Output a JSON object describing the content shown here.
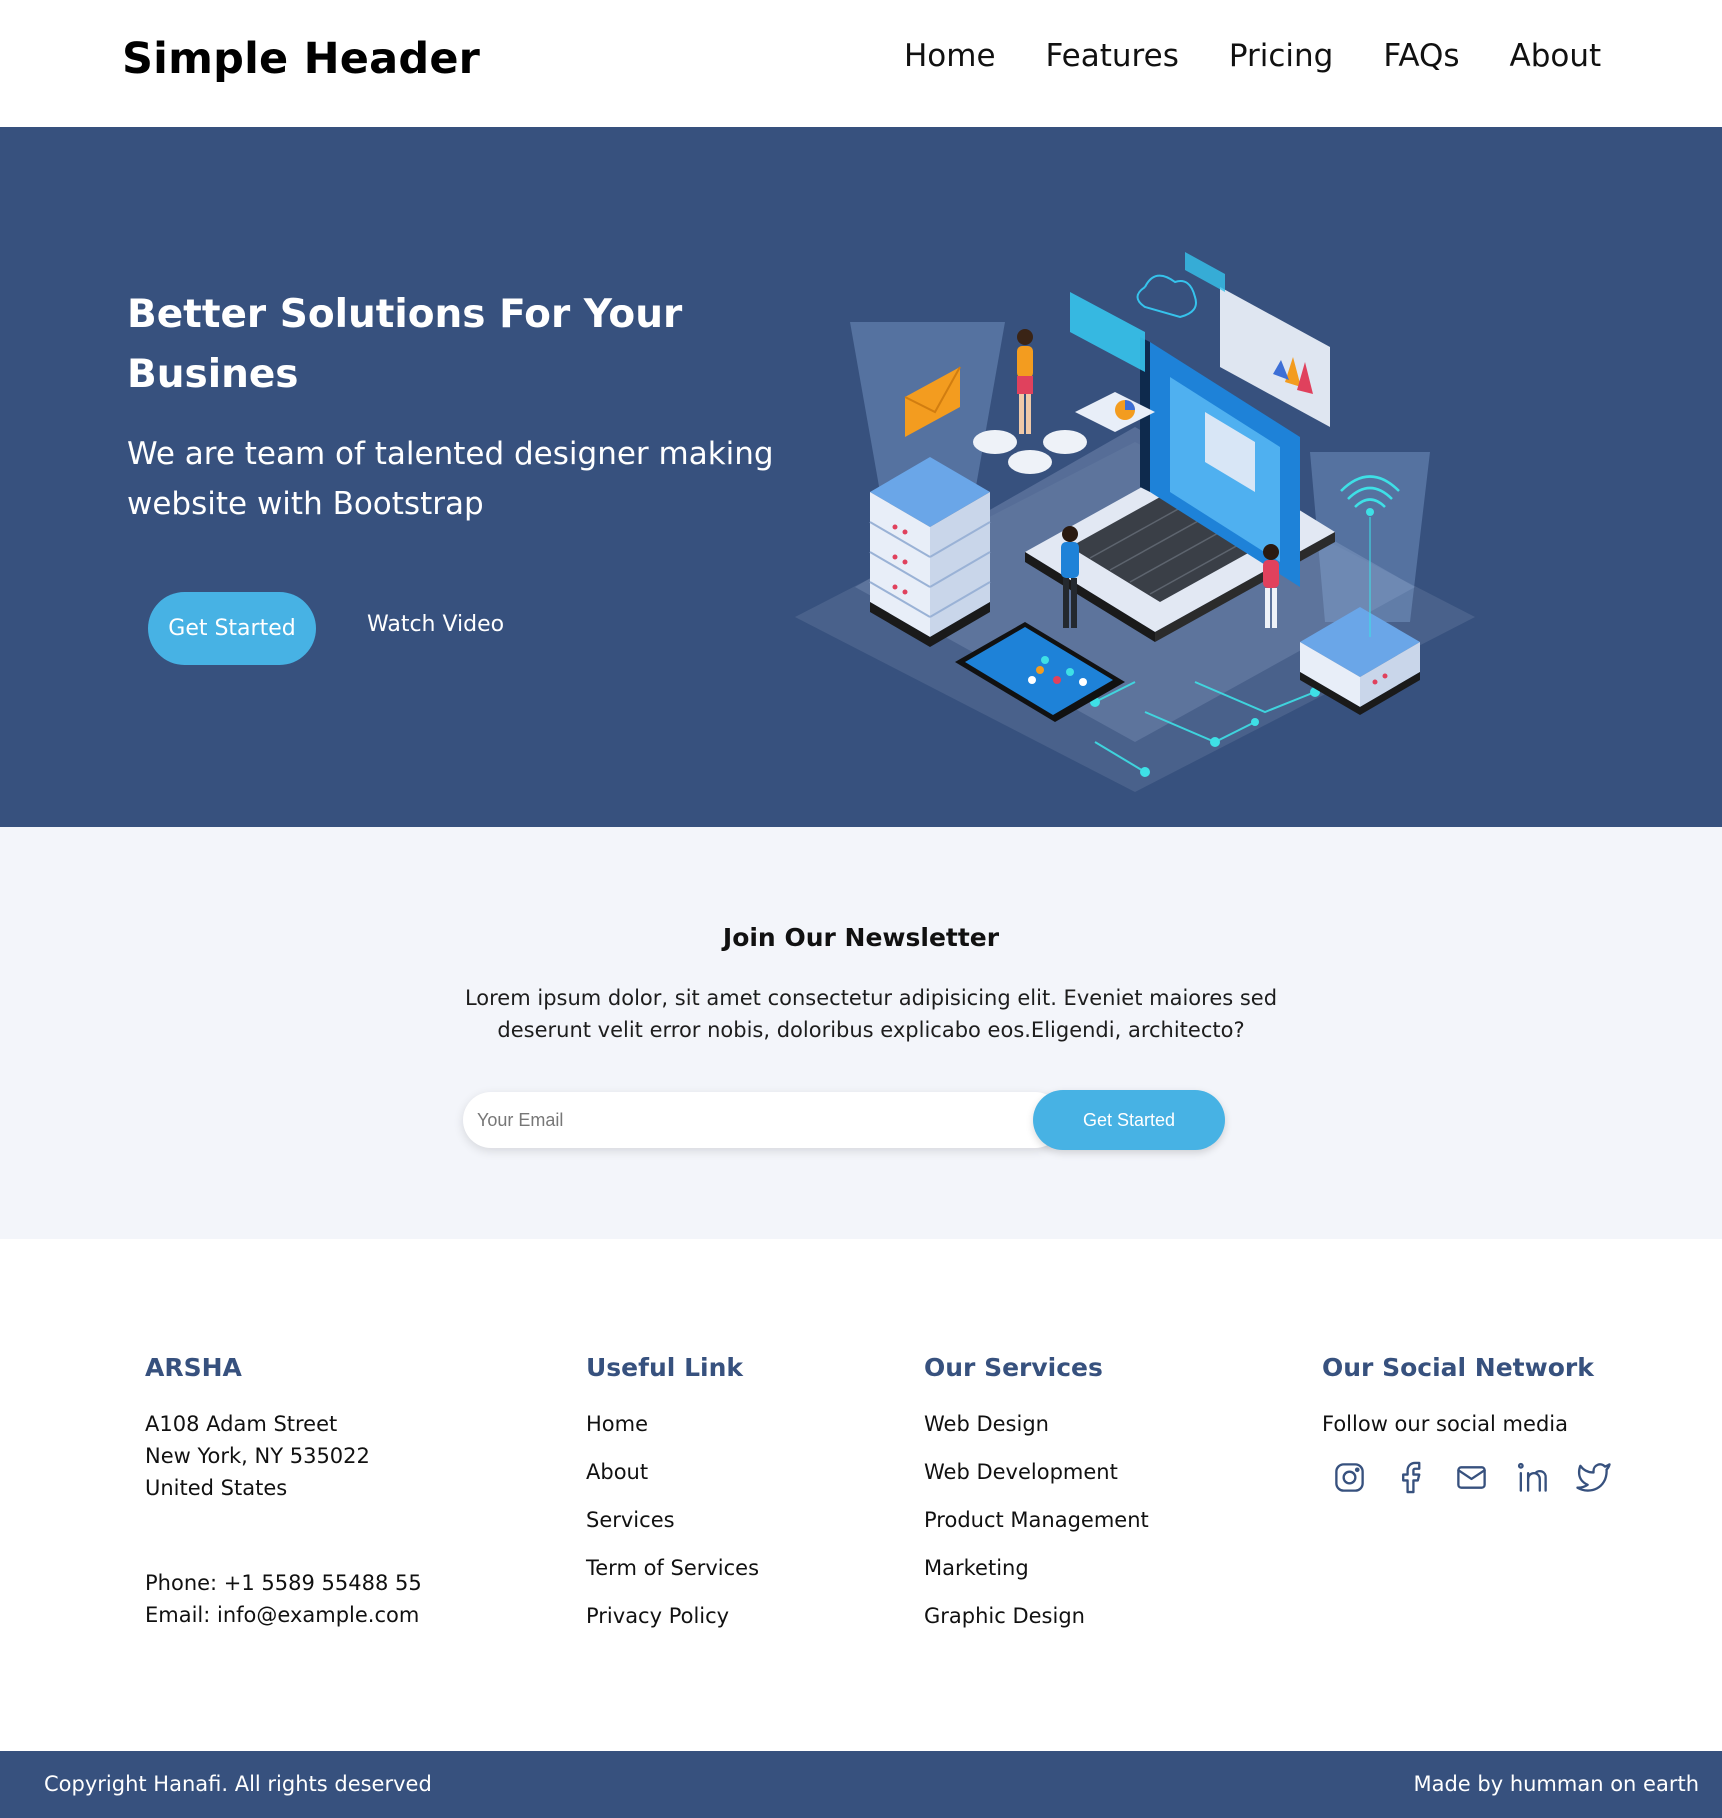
{
  "header": {
    "logo": "Simple Header",
    "nav": [
      "Home",
      "Features",
      "Pricing",
      "FAQs",
      "About"
    ]
  },
  "hero": {
    "title": "Better Solutions For Your Busines",
    "subtitle": "We are team of talented designer making website with Bootstrap",
    "cta_primary": "Get Started",
    "cta_secondary": "Watch Video"
  },
  "newsletter": {
    "title": "Join Our Newsletter",
    "text": "Lorem ipsum dolor, sit amet consectetur adipisicing elit. Eveniet maiores sed deserunt velit error nobis, doloribus explicabo eos.Eligendi, architecto?",
    "placeholder": "Your Email",
    "button": "Get Started"
  },
  "footer": {
    "brand": {
      "title": "ARSHA",
      "address": [
        "A108 Adam Street",
        "New York, NY 535022",
        "United States"
      ],
      "phone": "Phone: +1 5589 55488 55",
      "email": "Email: info@example.com"
    },
    "useful_links": {
      "title": "Useful Link",
      "items": [
        "Home",
        "About",
        "Services",
        "Term of Services",
        "Privacy Policy"
      ]
    },
    "services": {
      "title": "Our Services",
      "items": [
        "Web Design",
        "Web Development",
        "Product Management",
        "Marketing",
        "Graphic Design"
      ]
    },
    "social": {
      "title": "Our Social Network",
      "text": "Follow our social media",
      "icons": [
        "instagram-icon",
        "facebook-icon",
        "mail-icon",
        "linkedin-icon",
        "twitter-icon"
      ]
    }
  },
  "bottom": {
    "copyright": "Copyright Hanafi. All rights deserved",
    "made_by": "Made by humman on earth"
  },
  "colors": {
    "primary": "#37517e",
    "accent": "#47b2e4",
    "light_bg": "#f3f5fa"
  }
}
